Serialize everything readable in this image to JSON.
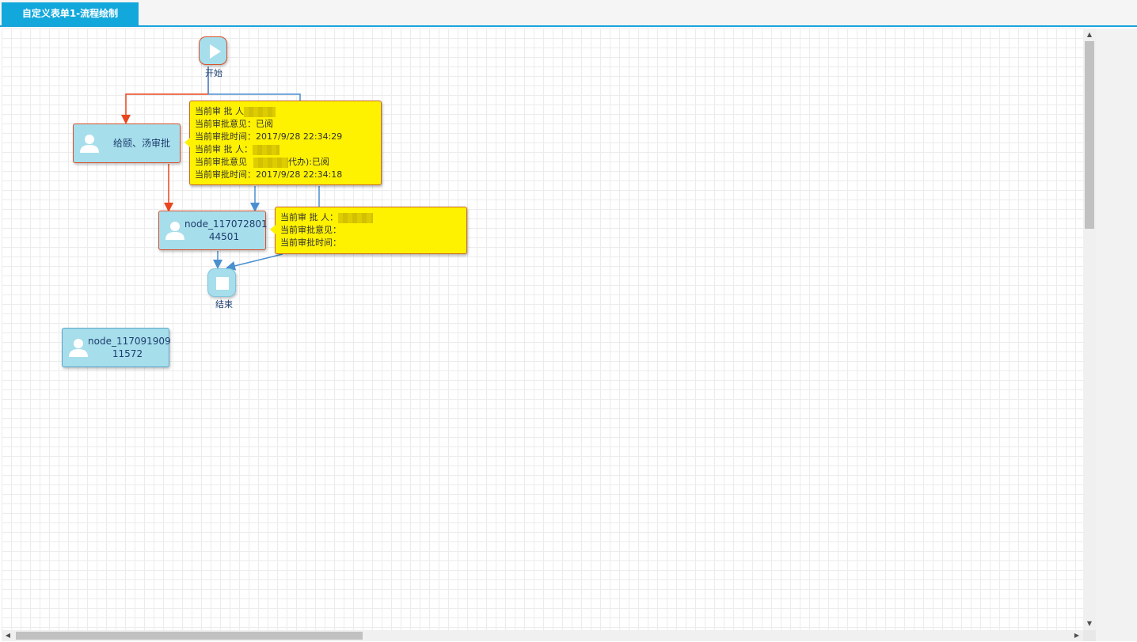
{
  "tab": {
    "title": "自定义表单1-流程绘制"
  },
  "nodes": {
    "start": {
      "label": "开始"
    },
    "end": {
      "label": "结束"
    },
    "approve": {
      "label": "给颐、汤审批"
    },
    "node_a": {
      "label": "node_117072801\n44501"
    },
    "node_b": {
      "label": "node_117091909\n11572"
    }
  },
  "tooltip1": {
    "approver_label": "当前审 批 人",
    "opinion_label": "当前审批意见：",
    "opinion_value": "已阅",
    "time_label": "当前审批时间：",
    "time_value": "2017/9/28 22:34:29",
    "approver2_label": "当前审 批 人：",
    "opinion2_label": "当前审批意见",
    "opinion2_suffix": "代办):已阅",
    "time2_label": "当前审批时间：",
    "time2_value": "2017/9/28 22:34:18"
  },
  "tooltip2": {
    "approver_label": "当前审 批 人：",
    "opinion_label": "当前审批意见：",
    "time_label": "当前审批时间："
  },
  "colors": {
    "accent": "#12a8dc",
    "node_fill": "#a7deec",
    "tooltip_fill": "#fff200",
    "edge_red": "#e8461f",
    "edge_blue": "#4a8fd0"
  }
}
